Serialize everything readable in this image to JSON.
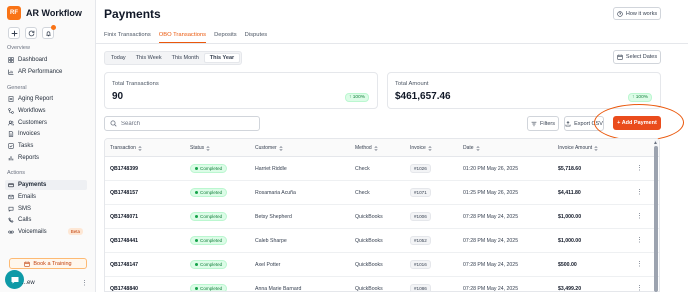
{
  "app": {
    "brand": "AR Workflow",
    "logo_text": "RF"
  },
  "sidebar": {
    "sections": [
      {
        "label": "Overview",
        "items": [
          {
            "label": "Dashboard",
            "icon": "grid-icon"
          },
          {
            "label": "AR Performance",
            "icon": "chart-icon"
          }
        ]
      },
      {
        "label": "General",
        "items": [
          {
            "label": "Aging Report",
            "icon": "report-icon"
          },
          {
            "label": "Workflows",
            "icon": "workflow-icon"
          },
          {
            "label": "Customers",
            "icon": "users-icon"
          },
          {
            "label": "Invoices",
            "icon": "invoice-icon"
          },
          {
            "label": "Tasks",
            "icon": "tasks-icon"
          },
          {
            "label": "Reports",
            "icon": "reports-icon"
          }
        ]
      },
      {
        "label": "Actions",
        "items": [
          {
            "label": "Payments",
            "icon": "payments-icon",
            "active": true
          },
          {
            "label": "Emails",
            "icon": "mail-icon"
          },
          {
            "label": "SMS",
            "icon": "sms-icon"
          },
          {
            "label": "Calls",
            "icon": "phone-icon"
          },
          {
            "label": "Voicemails",
            "icon": "voicemail-icon",
            "badge": "Beta"
          }
        ]
      }
    ],
    "book_training": "Book a Training",
    "user_name": "...ew"
  },
  "header": {
    "title": "Payments",
    "how_it_works": "How it works"
  },
  "tabs": [
    {
      "label": "Finix Transactions",
      "active": false
    },
    {
      "label": "OBO Transactions",
      "active": true
    },
    {
      "label": "Deposits",
      "active": false
    },
    {
      "label": "Disputes",
      "active": false
    }
  ],
  "range": [
    {
      "label": "Today",
      "active": false
    },
    {
      "label": "This Week",
      "active": false
    },
    {
      "label": "This Month",
      "active": false
    },
    {
      "label": "This Year",
      "active": true
    }
  ],
  "select_dates": "Select Dates",
  "stats": {
    "total_transactions": {
      "label": "Total Transactions",
      "value": "90",
      "badge": "↑ 100%"
    },
    "total_amount": {
      "label": "Total Amount",
      "value": "$461,657.46",
      "badge": "↑ 100%"
    }
  },
  "toolbar": {
    "search_placeholder": "Search",
    "filters": "Filters",
    "export": "Export CSV",
    "add_payment": "+ Add Payment"
  },
  "table": {
    "columns": [
      "Transaction",
      "Status",
      "Customer",
      "Method",
      "Invoice",
      "Date",
      "Invoice Amount"
    ],
    "rows": [
      {
        "txn": "QB1748399",
        "status": "Completed",
        "customer": "Harriet Riddle",
        "method": "Check",
        "invoice": "#1026",
        "date": "01:20 PM May 26, 2025",
        "amount": "$5,718.60"
      },
      {
        "txn": "QB1748157",
        "status": "Completed",
        "customer": "Rosamaria Acuña",
        "method": "Check",
        "invoice": "#1071",
        "date": "01:25 PM May 26, 2025",
        "amount": "$4,411.80"
      },
      {
        "txn": "QB1748071",
        "status": "Completed",
        "customer": "Betsy Shepherd",
        "method": "QuickBooks",
        "invoice": "#1006",
        "date": "07:28 PM May 24, 2025",
        "amount": "$1,000.00"
      },
      {
        "txn": "QB1748441",
        "status": "Completed",
        "customer": "Caleb Sharpe",
        "method": "QuickBooks",
        "invoice": "#1052",
        "date": "07:28 PM May 24, 2025",
        "amount": "$1,000.00"
      },
      {
        "txn": "QB1748147",
        "status": "Completed",
        "customer": "Axel Potter",
        "method": "QuickBooks",
        "invoice": "#1016",
        "date": "07:28 PM May 24, 2025",
        "amount": "$500.00"
      },
      {
        "txn": "QB1748840",
        "status": "Completed",
        "customer": "Anna Marie Barnard",
        "method": "QuickBooks",
        "invoice": "#1086",
        "date": "07:28 PM May 24, 2025",
        "amount": "$3,499.20"
      }
    ]
  },
  "colors": {
    "accent": "#ea580c",
    "primary_button": "#ea4c1c",
    "success": "#15803d"
  }
}
